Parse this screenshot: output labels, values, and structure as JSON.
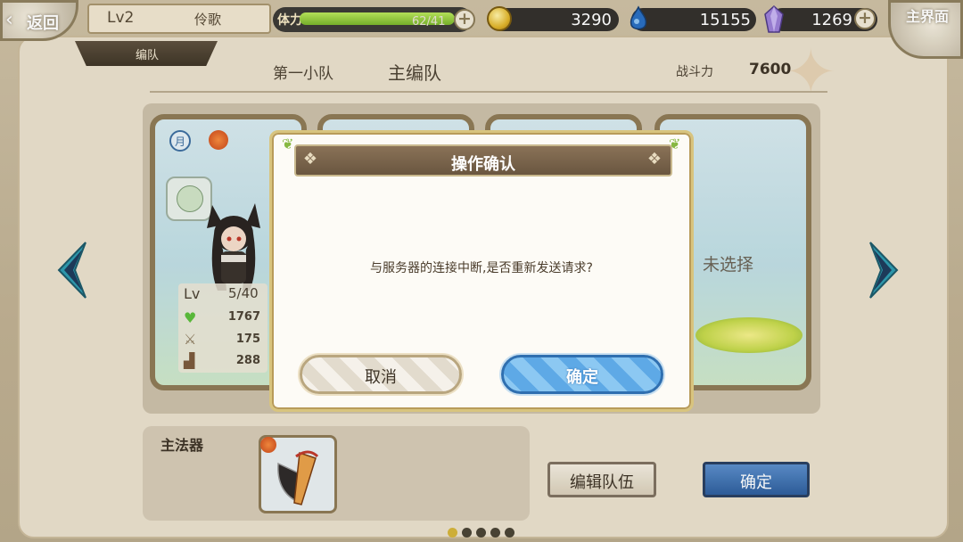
{
  "hud": {
    "back_label": "返回",
    "level": "Lv2",
    "player_name": "伶歌",
    "team_tab": "编队",
    "stamina_label": "体力",
    "stamina_value": "62/41",
    "stamina_fraction": 1.0,
    "gold": "3290",
    "gems": "15155",
    "crystals": "1269",
    "main_label": "主界面"
  },
  "header": {
    "squad_name": "第一小队",
    "formation_title": "主编队",
    "power_label": "战斗力",
    "power_value": "7600"
  },
  "cards": {
    "slot1": {
      "level_label": "Lv",
      "level": "5/40",
      "hp": "1767",
      "attack": "175",
      "speed": "288",
      "badge": "月"
    },
    "slot4": {
      "status": "未选择"
    }
  },
  "bottom": {
    "weapon_label": "主法器",
    "edit_label": "编辑队伍",
    "confirm_label": "确定",
    "page_count": 5,
    "current_page": 1
  },
  "dialog": {
    "title": "操作确认",
    "message": "与服务器的连接中断,是否重新发送请求?",
    "cancel_label": "取消",
    "ok_label": "确定"
  },
  "colors": {
    "accent_blue": "#5ea9e6",
    "stamina_green": "#7ab52c",
    "frame_brown": "#8e7a56"
  }
}
